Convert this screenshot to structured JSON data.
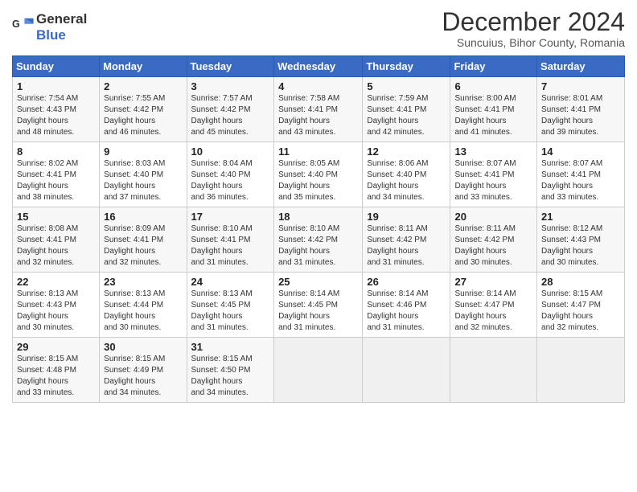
{
  "header": {
    "logo_line1": "General",
    "logo_line2": "Blue",
    "title": "December 2024",
    "subtitle": "Suncuius, Bihor County, Romania"
  },
  "columns": [
    "Sunday",
    "Monday",
    "Tuesday",
    "Wednesday",
    "Thursday",
    "Friday",
    "Saturday"
  ],
  "weeks": [
    [
      {
        "day": "1",
        "rise": "7:54 AM",
        "set": "4:43 PM",
        "daylight": "8 hours and 48 minutes."
      },
      {
        "day": "2",
        "rise": "7:55 AM",
        "set": "4:42 PM",
        "daylight": "8 hours and 46 minutes."
      },
      {
        "day": "3",
        "rise": "7:57 AM",
        "set": "4:42 PM",
        "daylight": "8 hours and 45 minutes."
      },
      {
        "day": "4",
        "rise": "7:58 AM",
        "set": "4:41 PM",
        "daylight": "8 hours and 43 minutes."
      },
      {
        "day": "5",
        "rise": "7:59 AM",
        "set": "4:41 PM",
        "daylight": "8 hours and 42 minutes."
      },
      {
        "day": "6",
        "rise": "8:00 AM",
        "set": "4:41 PM",
        "daylight": "8 hours and 41 minutes."
      },
      {
        "day": "7",
        "rise": "8:01 AM",
        "set": "4:41 PM",
        "daylight": "8 hours and 39 minutes."
      }
    ],
    [
      {
        "day": "8",
        "rise": "8:02 AM",
        "set": "4:41 PM",
        "daylight": "8 hours and 38 minutes."
      },
      {
        "day": "9",
        "rise": "8:03 AM",
        "set": "4:40 PM",
        "daylight": "8 hours and 37 minutes."
      },
      {
        "day": "10",
        "rise": "8:04 AM",
        "set": "4:40 PM",
        "daylight": "8 hours and 36 minutes."
      },
      {
        "day": "11",
        "rise": "8:05 AM",
        "set": "4:40 PM",
        "daylight": "8 hours and 35 minutes."
      },
      {
        "day": "12",
        "rise": "8:06 AM",
        "set": "4:40 PM",
        "daylight": "8 hours and 34 minutes."
      },
      {
        "day": "13",
        "rise": "8:07 AM",
        "set": "4:41 PM",
        "daylight": "8 hours and 33 minutes."
      },
      {
        "day": "14",
        "rise": "8:07 AM",
        "set": "4:41 PM",
        "daylight": "8 hours and 33 minutes."
      }
    ],
    [
      {
        "day": "15",
        "rise": "8:08 AM",
        "set": "4:41 PM",
        "daylight": "8 hours and 32 minutes."
      },
      {
        "day": "16",
        "rise": "8:09 AM",
        "set": "4:41 PM",
        "daylight": "8 hours and 32 minutes."
      },
      {
        "day": "17",
        "rise": "8:10 AM",
        "set": "4:41 PM",
        "daylight": "8 hours and 31 minutes."
      },
      {
        "day": "18",
        "rise": "8:10 AM",
        "set": "4:42 PM",
        "daylight": "8 hours and 31 minutes."
      },
      {
        "day": "19",
        "rise": "8:11 AM",
        "set": "4:42 PM",
        "daylight": "8 hours and 31 minutes."
      },
      {
        "day": "20",
        "rise": "8:11 AM",
        "set": "4:42 PM",
        "daylight": "8 hours and 30 minutes."
      },
      {
        "day": "21",
        "rise": "8:12 AM",
        "set": "4:43 PM",
        "daylight": "8 hours and 30 minutes."
      }
    ],
    [
      {
        "day": "22",
        "rise": "8:13 AM",
        "set": "4:43 PM",
        "daylight": "8 hours and 30 minutes."
      },
      {
        "day": "23",
        "rise": "8:13 AM",
        "set": "4:44 PM",
        "daylight": "8 hours and 30 minutes."
      },
      {
        "day": "24",
        "rise": "8:13 AM",
        "set": "4:45 PM",
        "daylight": "8 hours and 31 minutes."
      },
      {
        "day": "25",
        "rise": "8:14 AM",
        "set": "4:45 PM",
        "daylight": "8 hours and 31 minutes."
      },
      {
        "day": "26",
        "rise": "8:14 AM",
        "set": "4:46 PM",
        "daylight": "8 hours and 31 minutes."
      },
      {
        "day": "27",
        "rise": "8:14 AM",
        "set": "4:47 PM",
        "daylight": "8 hours and 32 minutes."
      },
      {
        "day": "28",
        "rise": "8:15 AM",
        "set": "4:47 PM",
        "daylight": "8 hours and 32 minutes."
      }
    ],
    [
      {
        "day": "29",
        "rise": "8:15 AM",
        "set": "4:48 PM",
        "daylight": "8 hours and 33 minutes."
      },
      {
        "day": "30",
        "rise": "8:15 AM",
        "set": "4:49 PM",
        "daylight": "8 hours and 34 minutes."
      },
      {
        "day": "31",
        "rise": "8:15 AM",
        "set": "4:50 PM",
        "daylight": "8 hours and 34 minutes."
      },
      null,
      null,
      null,
      null
    ]
  ]
}
